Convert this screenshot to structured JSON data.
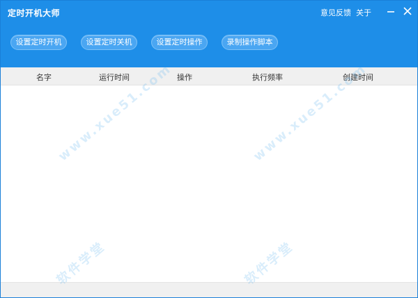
{
  "window": {
    "title": "定时开机大师"
  },
  "header_links": {
    "feedback": "意见反馈",
    "about": "关于"
  },
  "icons": {
    "minimize": "minimize-icon",
    "close": "close-icon"
  },
  "toolbar": {
    "buttons": [
      "设置定时开机",
      "设置定时关机",
      "设置定时操作",
      "录制操作脚本"
    ]
  },
  "table": {
    "columns": [
      "名字",
      "运行时间",
      "操作",
      "执行频率",
      "创建时间"
    ],
    "rows": []
  },
  "watermark": {
    "text_cn": "软件学堂",
    "text_url": "www.xue51.com"
  },
  "colors": {
    "header_bg": "#1e8ee8",
    "button_bg": "#4aa6f2",
    "column_header_bg": "#f0f0f0",
    "border": "#1a7fd8"
  }
}
